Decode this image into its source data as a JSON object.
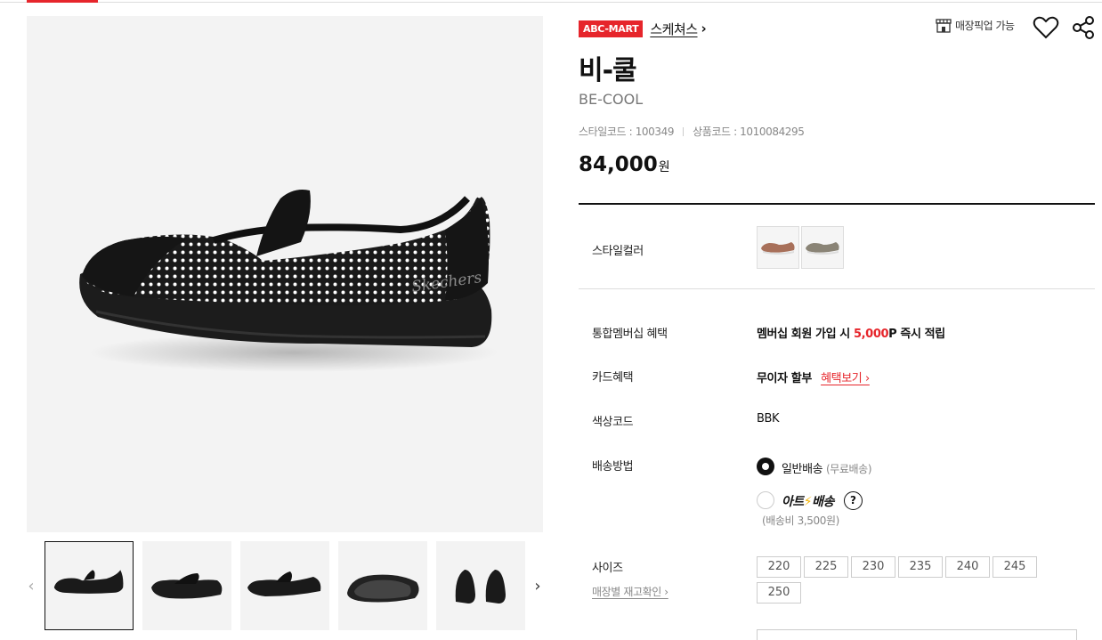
{
  "brand": {
    "badge": "ABC-MART",
    "name": "스케쳐스",
    "chevron": "›"
  },
  "header_actions": {
    "pickup_label": "매장픽업 가능",
    "pickup_icon": "store-icon",
    "wishlist_icon": "heart-icon",
    "share_icon": "share-icon"
  },
  "product": {
    "title": "비-쿨",
    "subtitle": "BE-COOL",
    "style_code_label": "스타일코드 :",
    "style_code": "100349",
    "product_code_label": "상품코드 :",
    "product_code": "1010084295",
    "price": "84,000",
    "price_unit": "원"
  },
  "options": {
    "style_color_label": "스타일컬러",
    "membership_label": "통합멤버십 혜택",
    "membership_text_prefix": "멤버십 회원 가입 시",
    "membership_points": "5,000",
    "membership_text_suffix": "P 즉시 적립",
    "card_label": "카드혜택",
    "card_text": "무이자 할부",
    "card_link": "혜택보기 ›",
    "color_code_label": "색상코드",
    "color_code": "BBK",
    "shipping_label": "배송방법",
    "shipping_standard": "일반배송",
    "shipping_standard_note": "(무료배송)",
    "shipping_arte_brand_a": "아트",
    "shipping_arte_brand_b": "배송",
    "shipping_arte_help": "?",
    "shipping_arte_note": "(배송비 3,500원)",
    "size_label": "사이즈",
    "stock_link": "매장별 재고확인 ›",
    "sizes": [
      "220",
      "225",
      "230",
      "235",
      "240",
      "245",
      "250"
    ],
    "selected_shipping": "standard"
  },
  "gallery": {
    "prev": "‹",
    "next": "›",
    "thumb_count": 5,
    "active_index": 0
  },
  "colors": {
    "accent": "#e6252b",
    "text": "#111111",
    "muted": "#888888"
  }
}
